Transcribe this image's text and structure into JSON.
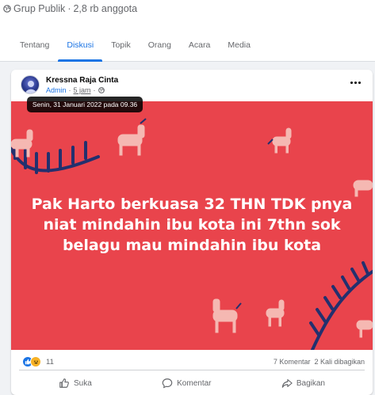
{
  "group": {
    "privacy_label": "Grup Publik",
    "separator": "·",
    "members": "2,8 rb anggota"
  },
  "tabs": [
    {
      "label": "Tentang",
      "active": false
    },
    {
      "label": "Diskusi",
      "active": true
    },
    {
      "label": "Topik",
      "active": false
    },
    {
      "label": "Orang",
      "active": false
    },
    {
      "label": "Acara",
      "active": false
    },
    {
      "label": "Media",
      "active": false
    }
  ],
  "post": {
    "author": "Kressna Raja Cinta",
    "role": "Admin",
    "separator": "·",
    "time": "5 jam",
    "tooltip": "Senin, 31 Januari 2022 pada 09.36",
    "text": "Pak Harto berkuasa 32 THN TDK pnya niat mindahin ibu kota ini 7thn sok belagu mau mindahin ibu kota",
    "background_color": "#e9444c",
    "reaction_count": "11",
    "comments": "7 Komentar",
    "shares": "2 Kali dibagikan",
    "actions": {
      "like": "Suka",
      "comment": "Komentar",
      "share": "Bagikan"
    }
  },
  "colors": {
    "accent": "#1b74e4",
    "muted": "#65676b"
  }
}
